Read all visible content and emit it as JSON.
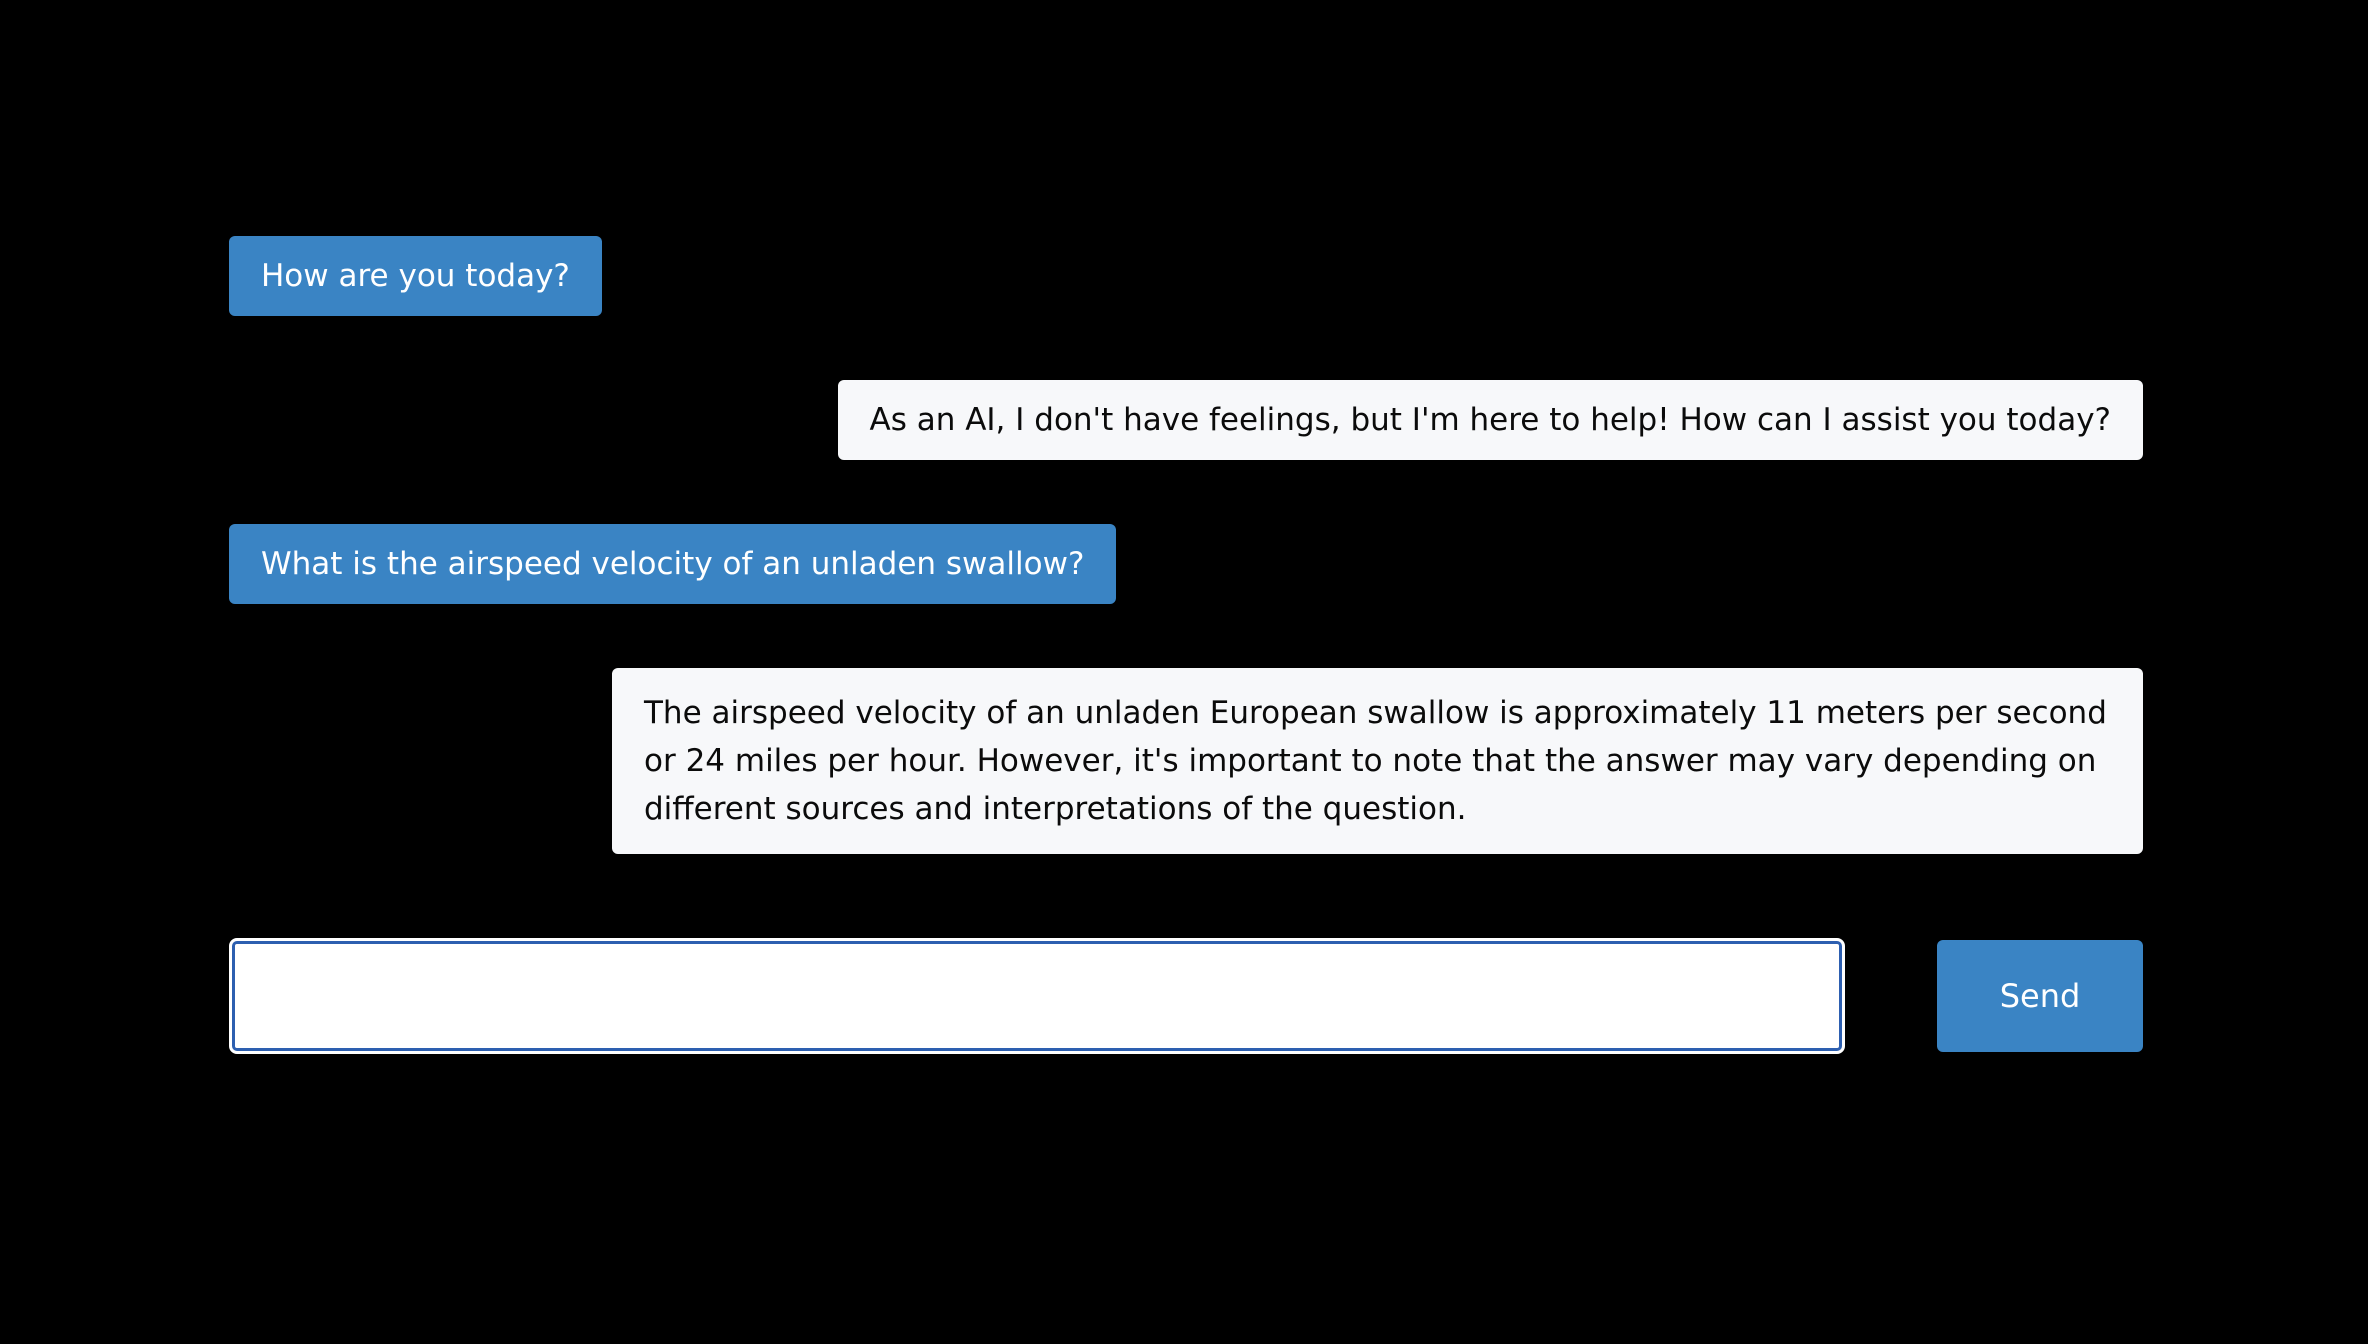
{
  "messages": [
    {
      "role": "user",
      "text": "How are you today?"
    },
    {
      "role": "assistant",
      "text": "As an AI, I don't have feelings, but I'm here to help! How can I assist you today?"
    },
    {
      "role": "user",
      "text": "What is the airspeed velocity of an unladen swallow?"
    },
    {
      "role": "assistant",
      "text": "The airspeed velocity of an unladen European swallow is approximately 11 meters per second or 24 miles per hour. However, it's important to note that the answer may vary depending on different sources and interpretations of the question."
    }
  ],
  "composer": {
    "value": "",
    "send_label": "Send"
  },
  "colors": {
    "background": "#000000",
    "user_bubble": "#3a84c4",
    "assistant_bubble": "#f7f8fa",
    "send_button": "#3a84c4",
    "input_focus_ring": "#2d5fb0"
  }
}
